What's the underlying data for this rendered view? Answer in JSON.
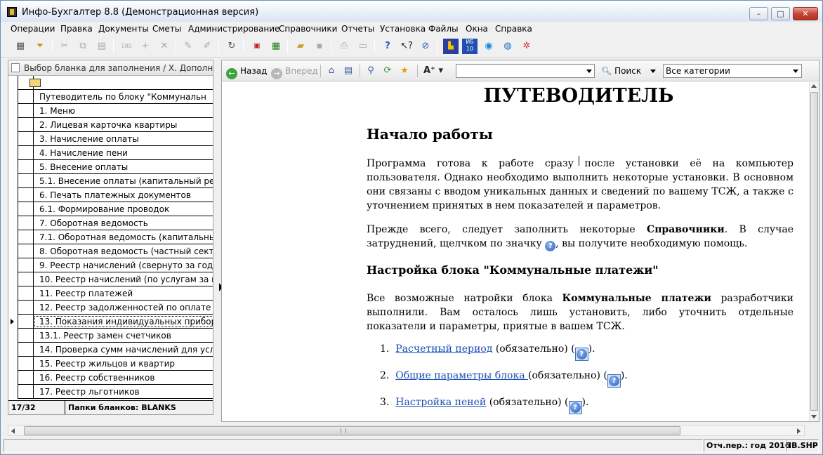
{
  "window": {
    "title": "Инфо-Бухгалтер 8.8 (Демонстрационная версия)",
    "controls": {
      "minimize": "–",
      "maximize": "□",
      "close": "✕"
    }
  },
  "menu": [
    "Операции",
    "Правка",
    "Документы",
    "Сметы",
    "Администрирование",
    "Справочники",
    "Отчеты",
    "Установка",
    "Файлы",
    "Окна",
    "Справка"
  ],
  "left_panel": {
    "header": "Выбор бланка для заполнения / Х. Дополнитель",
    "rows": [
      "Путеводитель по блоку \"Коммунальн",
      "1. Меню",
      "2. Лицевая карточка квартиры",
      "3. Начисление оплаты",
      "4. Начисление пени",
      "5. Внесение оплаты",
      "5.1. Внесение оплаты (капитальный рем",
      "6. Печать платежных документов",
      "6.1. Формирование проводок",
      "7. Оборотная ведомость",
      "7.1. Оборотная ведомость (капитальны",
      "8. Оборотная ведомость (частный секто",
      "9. Реестр начислений (свернуто за год)",
      "10. Реестр начислений (по услугам за м",
      "11. Реестр платежей",
      "12. Реестр задолженностей по оплате",
      "13. Показания индивидуальных приборо",
      "13.1. Реестр замен счетчиков",
      "14. Проверка сумм начислений для усл",
      "15. Реестр жильцов и квартир",
      "16. Реестр собственников",
      "17. Реестр льготников"
    ],
    "selected_row": 16,
    "status_count": "17/32",
    "status_folder": "Папки бланков: BLANKS"
  },
  "help_toolbar": {
    "back": "Назад",
    "forward": "Вперед",
    "search_value": "",
    "search_button": "Поиск",
    "category": "Все категории"
  },
  "help_content": {
    "title": "ПУТЕВОДИТЕЛЬ",
    "h1": "Начало работы",
    "p1": "Программа готова к работе сразу после установки её на компьютер пользователя. Однако необходимо выполнить некоторые установки. В основном они связаны с вводом уникальных данных и сведений по вашему ТСЖ, а также с уточнением принятых в нем показателей и параметров.",
    "p2_before": "Прежде всего, следует заполнить некоторые ",
    "p2_bold": "Справочники",
    "p2_mid": ". В случае затруднений, щелчком по значку ",
    "p2_after": ", вы получите необходимую помощь.",
    "h2": "Настройка блока \"Коммунальные платежи\"",
    "p3_before": "Все возможные натройки блока ",
    "p3_bold": "Коммунальные платежи",
    "p3_after": " разработчики выполнили. Вам осталось лишь установить, либо уточнить отдельные показатели и параметры, приятые в вашем ТСЖ.",
    "list": [
      {
        "num": "1.",
        "link": "Расчетный период",
        "note": " (обязательно) (",
        "end": ")."
      },
      {
        "num": "2.",
        "link": "Общие параметры блока ",
        "note": " (обязательно) (",
        "end": ")."
      },
      {
        "num": "3.",
        "link": "Настройка пеней",
        "note": " (обязательно) (",
        "end": ")."
      }
    ],
    "help_glyph": "?"
  },
  "statusbar": {
    "period": "Отч.пер.: год 2016",
    "db": "IB.SHP"
  }
}
